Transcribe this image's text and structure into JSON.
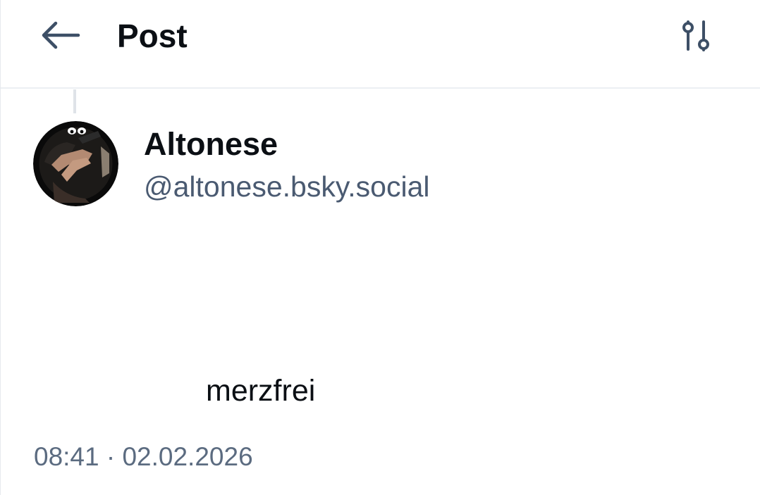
{
  "header": {
    "title": "Post",
    "back_icon": "arrow-left-icon",
    "settings_icon": "sliders-icon"
  },
  "post": {
    "author": {
      "display_name": "Altonese",
      "handle": "@altonese.bsky.social"
    },
    "text": "merzfrei",
    "timestamp": "08:41 · 02.02.2026"
  },
  "colors": {
    "icon": "#3d4f66",
    "text_primary": "#0b0f14",
    "text_secondary": "#4a5a71",
    "divider": "#eceff3"
  }
}
